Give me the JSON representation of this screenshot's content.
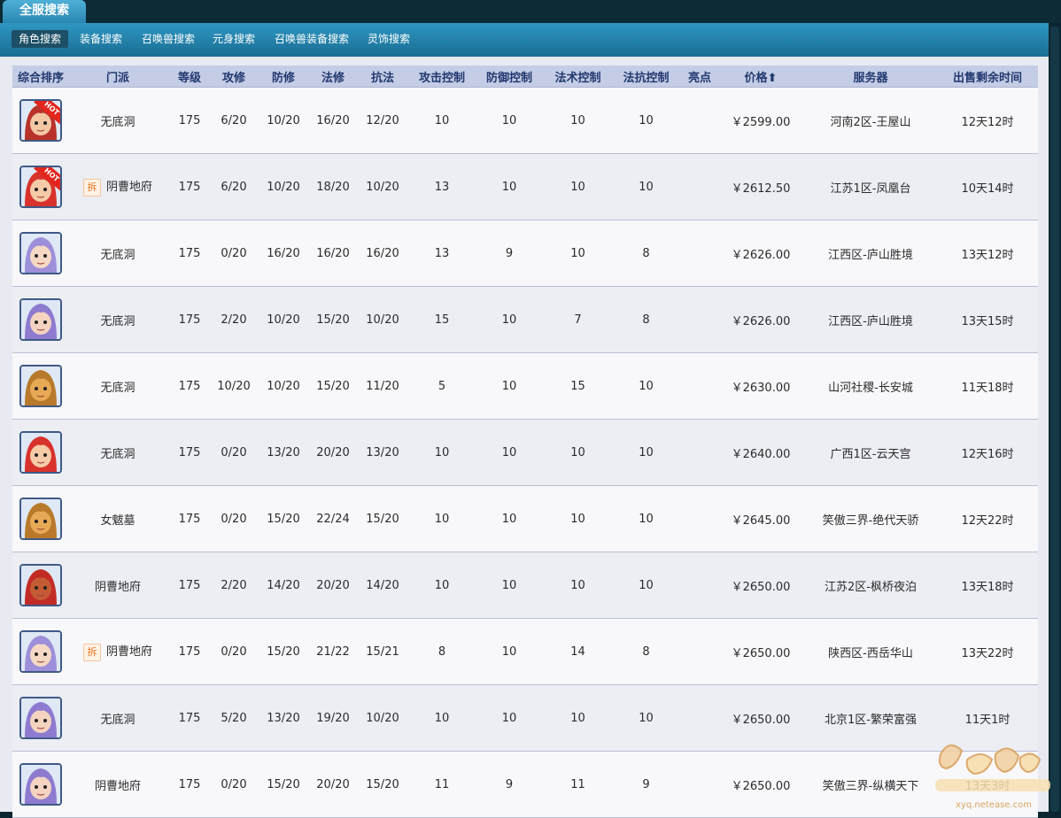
{
  "app": {
    "main_tab": "全服搜索",
    "subnav": [
      "角色搜索",
      "装备搜索",
      "召唤兽搜索",
      "元身搜索",
      "召唤兽装备搜索",
      "灵饰搜索"
    ],
    "active_subnav": 0
  },
  "table": {
    "headers": [
      "综合排序",
      "门派",
      "等级",
      "攻修",
      "防修",
      "法修",
      "抗法",
      "攻击控制",
      "防御控制",
      "法术控制",
      "法抗控制",
      "亮点",
      "价格⬆",
      "服务器",
      "出售剩余时间"
    ],
    "rows": [
      {
        "avatar": "red-hair-girl",
        "hot": true,
        "chai": false,
        "sect": "无底洞",
        "level": "175",
        "atk": "6/20",
        "def": "10/20",
        "mag": "16/20",
        "res": "12/20",
        "atk_ctrl": "10",
        "def_ctrl": "10",
        "mag_ctrl": "10",
        "res_ctrl": "10",
        "highlight": "",
        "price": "￥2599.00",
        "server": "河南2区-王屋山",
        "remaining": "12天12时"
      },
      {
        "avatar": "red-hair-hero",
        "hot": true,
        "chai": true,
        "chai_label": "拆",
        "sect": "阴曹地府",
        "level": "175",
        "atk": "6/20",
        "def": "10/20",
        "mag": "18/20",
        "res": "10/20",
        "atk_ctrl": "13",
        "def_ctrl": "10",
        "mag_ctrl": "10",
        "res_ctrl": "10",
        "highlight": "",
        "price": "￥2612.50",
        "server": "江苏1区-凤凰台",
        "remaining": "10天14时"
      },
      {
        "avatar": "purple-hair",
        "hot": false,
        "chai": false,
        "sect": "无底洞",
        "level": "175",
        "atk": "0/20",
        "def": "16/20",
        "mag": "16/20",
        "res": "16/20",
        "atk_ctrl": "13",
        "def_ctrl": "9",
        "mag_ctrl": "10",
        "res_ctrl": "8",
        "highlight": "",
        "price": "￥2626.00",
        "server": "江西区-庐山胜境",
        "remaining": "13天12时"
      },
      {
        "avatar": "purple-hair-green-eyes",
        "hot": false,
        "chai": false,
        "sect": "无底洞",
        "level": "175",
        "atk": "2/20",
        "def": "10/20",
        "mag": "15/20",
        "res": "10/20",
        "atk_ctrl": "15",
        "def_ctrl": "10",
        "mag_ctrl": "7",
        "res_ctrl": "8",
        "highlight": "",
        "price": "￥2626.00",
        "server": "江西区-庐山胜境",
        "remaining": "13天15时"
      },
      {
        "avatar": "tiger-beast",
        "hot": false,
        "chai": false,
        "sect": "无底洞",
        "level": "175",
        "atk": "10/20",
        "def": "10/20",
        "mag": "15/20",
        "res": "11/20",
        "atk_ctrl": "5",
        "def_ctrl": "10",
        "mag_ctrl": "15",
        "res_ctrl": "10",
        "highlight": "",
        "price": "￥2630.00",
        "server": "山河社稷-长安城",
        "remaining": "11天18时"
      },
      {
        "avatar": "red-hair-hero",
        "hot": false,
        "chai": false,
        "sect": "无底洞",
        "level": "175",
        "atk": "0/20",
        "def": "13/20",
        "mag": "20/20",
        "res": "13/20",
        "atk_ctrl": "10",
        "def_ctrl": "10",
        "mag_ctrl": "10",
        "res_ctrl": "10",
        "highlight": "",
        "price": "￥2640.00",
        "server": "广西1区-云天宫",
        "remaining": "12天16时"
      },
      {
        "avatar": "tiger-beast",
        "hot": false,
        "chai": false,
        "sect": "女魃墓",
        "level": "175",
        "atk": "0/20",
        "def": "15/20",
        "mag": "22/24",
        "res": "15/20",
        "atk_ctrl": "10",
        "def_ctrl": "10",
        "mag_ctrl": "10",
        "res_ctrl": "10",
        "highlight": "",
        "price": "￥2645.00",
        "server": "笑傲三界-绝代天骄",
        "remaining": "12天22时"
      },
      {
        "avatar": "red-demon",
        "hot": false,
        "chai": false,
        "sect": "阴曹地府",
        "level": "175",
        "atk": "2/20",
        "def": "14/20",
        "mag": "20/20",
        "res": "14/20",
        "atk_ctrl": "10",
        "def_ctrl": "10",
        "mag_ctrl": "10",
        "res_ctrl": "10",
        "highlight": "",
        "price": "￥2650.00",
        "server": "江苏2区-枫桥夜泊",
        "remaining": "13天18时"
      },
      {
        "avatar": "purple-hair",
        "hot": false,
        "chai": true,
        "chai_label": "拆",
        "sect": "阴曹地府",
        "level": "175",
        "atk": "0/20",
        "def": "15/20",
        "mag": "21/22",
        "res": "15/21",
        "atk_ctrl": "8",
        "def_ctrl": "10",
        "mag_ctrl": "14",
        "res_ctrl": "8",
        "highlight": "",
        "price": "￥2650.00",
        "server": "陕西区-西岳华山",
        "remaining": "13天22时"
      },
      {
        "avatar": "purple-hair-green-eyes",
        "hot": false,
        "chai": false,
        "sect": "无底洞",
        "level": "175",
        "atk": "5/20",
        "def": "13/20",
        "mag": "19/20",
        "res": "10/20",
        "atk_ctrl": "10",
        "def_ctrl": "10",
        "mag_ctrl": "10",
        "res_ctrl": "10",
        "highlight": "",
        "price": "￥2650.00",
        "server": "北京1区-繁荣富强",
        "remaining": "11天1时"
      },
      {
        "avatar": "purple-hair-green-eyes",
        "hot": false,
        "chai": false,
        "sect": "阴曹地府",
        "level": "175",
        "atk": "0/20",
        "def": "15/20",
        "mag": "20/20",
        "res": "15/20",
        "atk_ctrl": "11",
        "def_ctrl": "9",
        "mag_ctrl": "11",
        "res_ctrl": "9",
        "highlight": "",
        "price": "￥2650.00",
        "server": "笑傲三界-纵横天下",
        "remaining": "13天3时"
      }
    ]
  },
  "colors": {
    "header_bg": "#c5cde6",
    "header_text": "#21376e",
    "price_green": "#1aa21a",
    "nav_blue": "#2e97c2"
  },
  "watermark": {
    "icon": "game-logo-watermark",
    "text": "xyq.netease.com"
  }
}
